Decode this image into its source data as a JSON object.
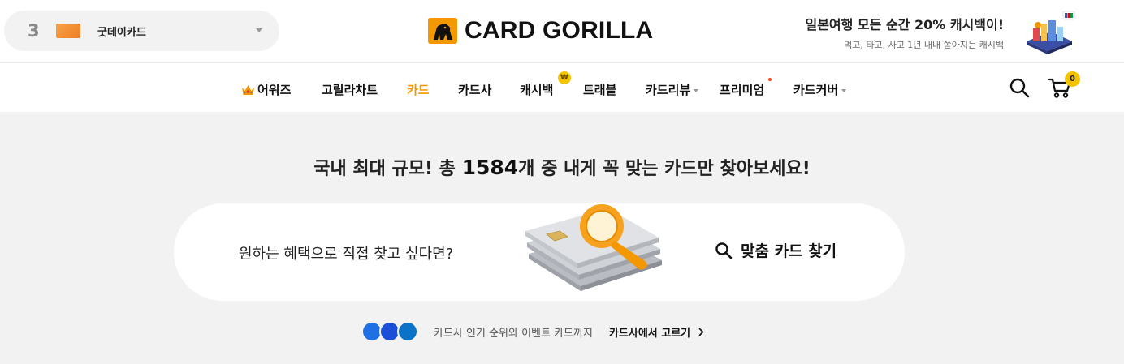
{
  "ranking": {
    "rank": "3",
    "card_name": "굿데이카드"
  },
  "brand": {
    "name": "CARD GORILLA"
  },
  "promo": {
    "title": "일본여행 모든 순간 20% 캐시백이!",
    "subtitle": "먹고, 타고, 사고 1년 내내 쏟아지는 캐시백"
  },
  "nav": {
    "items": [
      "어워즈",
      "고릴라차트",
      "카드",
      "카드사",
      "캐시백",
      "트래블",
      "카드리뷰",
      "프리미엄",
      "카드커버"
    ],
    "active": "카드",
    "cashback_badge": "₩",
    "cart_count": "0"
  },
  "hero": {
    "headline_prefix": "국내 최대 규모! 총 ",
    "card_count": "1584",
    "headline_suffix": "개 중 내게 꼭 맞는 카드만 찾아보세요!"
  },
  "finder": {
    "prompt": "원하는 혜택으로 직접 찾고 싶다면?",
    "cta_label": "맞춤 카드 찾기"
  },
  "issuers": {
    "description": "카드사 인기 순위와 이벤트 카드까지",
    "link_label": "카드사에서 고르기",
    "logo_colors": [
      "#1f6fe5",
      "#1b4fd8",
      "#0a73c8"
    ]
  },
  "colors": {
    "accent": "#f39800",
    "badge": "#f5c400",
    "background": "#f2f2f2"
  }
}
